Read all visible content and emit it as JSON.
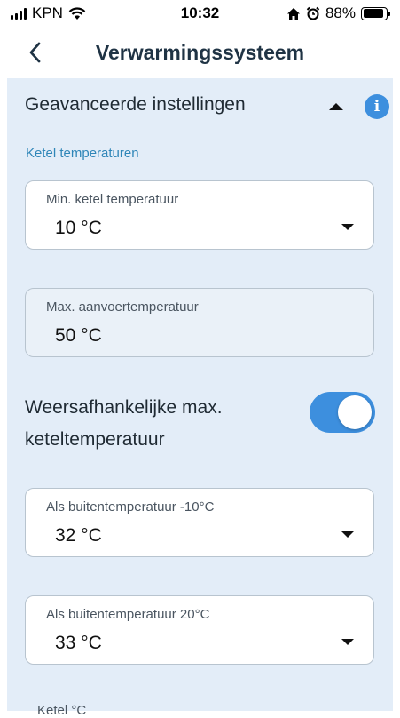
{
  "status_bar": {
    "carrier": "KPN",
    "time": "10:32",
    "battery_percent": "88%",
    "battery_level": 0.88,
    "icons": [
      "signal-icon",
      "wifi-icon",
      "home-icon",
      "alarm-icon",
      "battery-icon"
    ]
  },
  "nav": {
    "title": "Verwarmingssysteem",
    "back_icon": "chevron-left-icon"
  },
  "section": {
    "title": "Geavanceerde instellingen",
    "expanded": true,
    "subheading": "Ketel temperaturen"
  },
  "fields": [
    {
      "label": "Min. ketel temperatuur",
      "value": "10 °C",
      "type": "dropdown"
    },
    {
      "label": "Max. aanvoertemperatuur",
      "value": "50 °C",
      "type": "readonly"
    },
    {
      "label": "Als buitentemperatuur -10°C",
      "value": "32 °C",
      "type": "dropdown"
    },
    {
      "label": "Als buitentemperatuur 20°C",
      "value": "33 °C",
      "type": "dropdown"
    }
  ],
  "weather_toggle": {
    "label": "Weersafhankelijke max. keteltemperatuur",
    "on": true
  },
  "cutoff_label": "Ketel °C",
  "colors": {
    "accent": "#3d8fde",
    "panel_bg": "#e3edf8",
    "link": "#2f86b8",
    "title": "#1f3344"
  }
}
